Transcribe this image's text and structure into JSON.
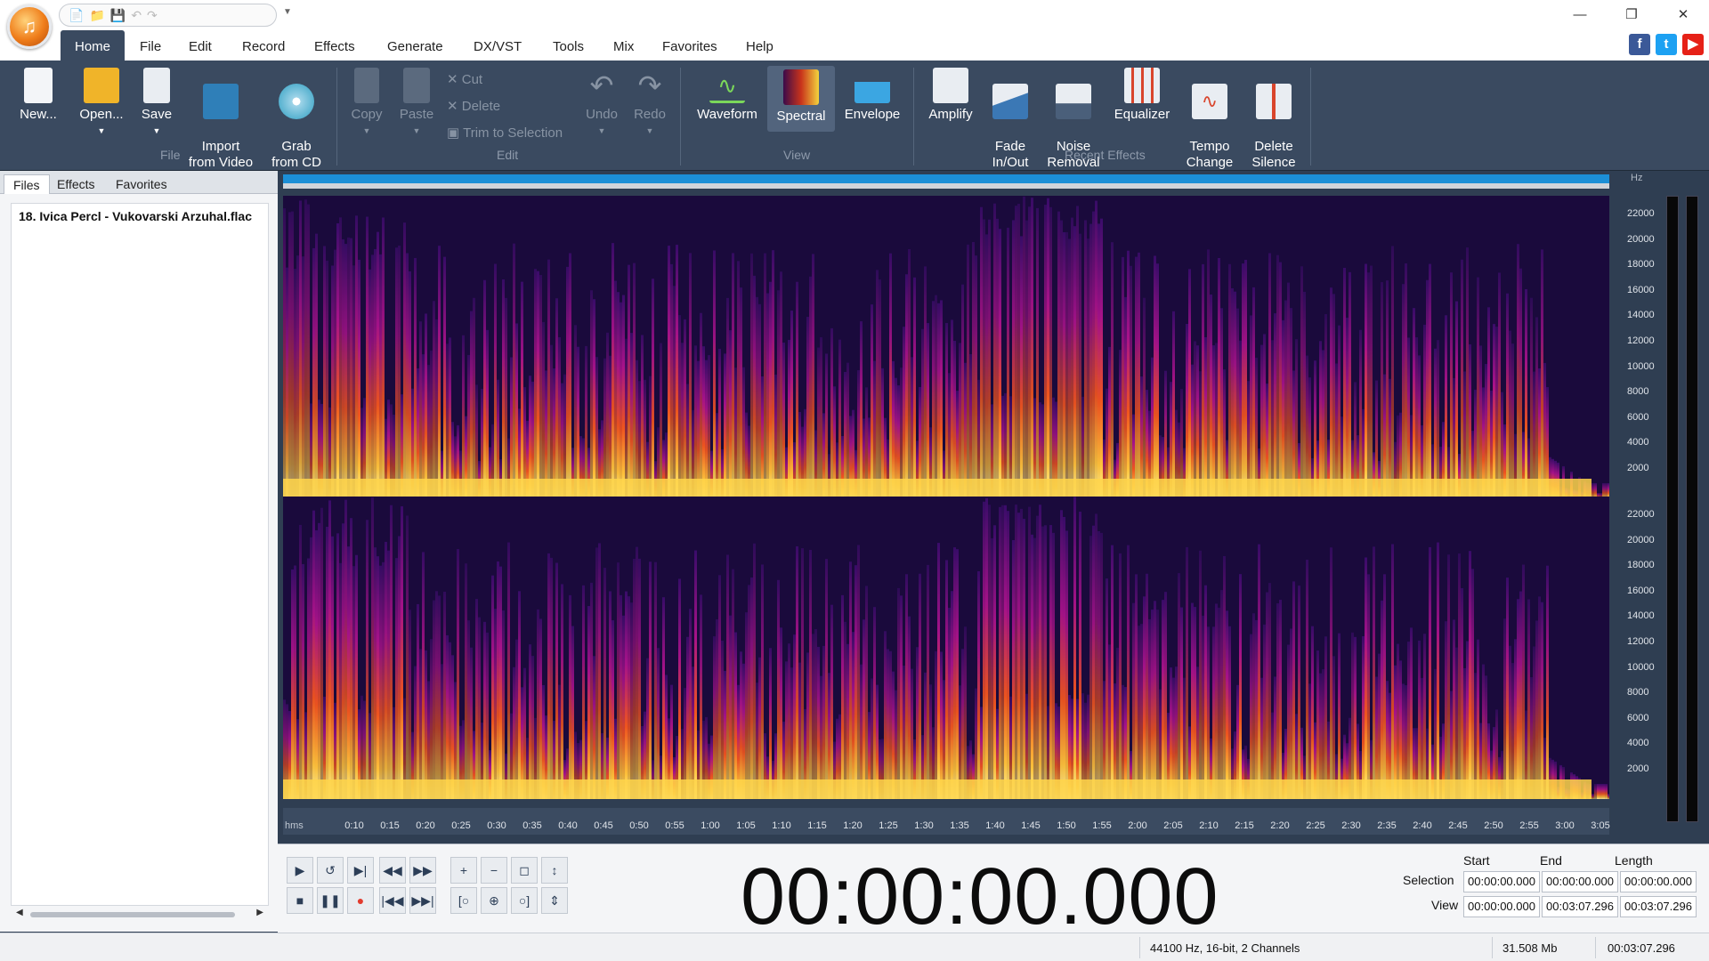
{
  "titlebar": {
    "window_controls": {
      "minimize": "—",
      "restore": "❐",
      "close": "✕"
    }
  },
  "menu": {
    "items": [
      "Home",
      "File",
      "Edit",
      "Record",
      "Effects",
      "Generate",
      "DX/VST",
      "Tools",
      "Mix",
      "Favorites",
      "Help"
    ]
  },
  "ribbon": {
    "file_group": {
      "label": "File",
      "new": "New...",
      "open": "Open...",
      "save": "Save",
      "import": "Import\nfrom Video",
      "grab": "Grab\nfrom CD"
    },
    "edit_group": {
      "label": "Edit",
      "copy": "Copy",
      "paste": "Paste",
      "cut": "Cut",
      "delete": "Delete",
      "trim": "Trim to Selection",
      "undo": "Undo",
      "redo": "Redo"
    },
    "view_group": {
      "label": "View",
      "waveform": "Waveform",
      "spectral": "Spectral",
      "envelope": "Envelope"
    },
    "effects_group": {
      "label": "Recent Effects",
      "amplify": "Amplify",
      "fade": "Fade\nIn/Out",
      "noise": "Noise\nRemoval",
      "equalizer": "Equalizer",
      "tempo": "Tempo\nChange",
      "silence": "Delete\nSilence"
    }
  },
  "panel": {
    "tabs": [
      "Files",
      "Effects",
      "Favorites"
    ],
    "files": [
      "18. Ivica Percl - Vukovarski Arzuhal.flac"
    ]
  },
  "spectrogram": {
    "unit": "Hz",
    "freq_labels": [
      "22000",
      "20000",
      "18000",
      "16000",
      "14000",
      "12000",
      "10000",
      "8000",
      "6000",
      "4000",
      "2000"
    ],
    "time_unit": "hms",
    "time_labels": [
      "0:10",
      "0:15",
      "0:20",
      "0:25",
      "0:30",
      "0:35",
      "0:40",
      "0:45",
      "0:50",
      "0:55",
      "1:00",
      "1:05",
      "1:10",
      "1:15",
      "1:20",
      "1:25",
      "1:30",
      "1:35",
      "1:40",
      "1:45",
      "1:50",
      "1:55",
      "2:00",
      "2:05",
      "2:10",
      "2:15",
      "2:20",
      "2:25",
      "2:30",
      "2:35",
      "2:40",
      "2:45",
      "2:50",
      "2:55",
      "3:00",
      "3:05"
    ]
  },
  "playback": {
    "time": "00:00:00.000"
  },
  "selection": {
    "headers": [
      "Start",
      "End",
      "Length"
    ],
    "selection_label": "Selection",
    "view_label": "View",
    "selection": [
      "00:00:00.000",
      "00:00:00.000",
      "00:00:00.000"
    ],
    "view": [
      "00:00:00.000",
      "00:03:07.296",
      "00:03:07.296"
    ]
  },
  "status": {
    "format": "44100 Hz, 16-bit, 2 Channels",
    "size": "31.508 Mb",
    "duration": "00:03:07.296"
  },
  "colors": {
    "accent": "#3a4a60",
    "overview": "#1c8fd6",
    "spectrum_low": "#1a0a3c",
    "spectrum_high": "#ffe66a"
  }
}
